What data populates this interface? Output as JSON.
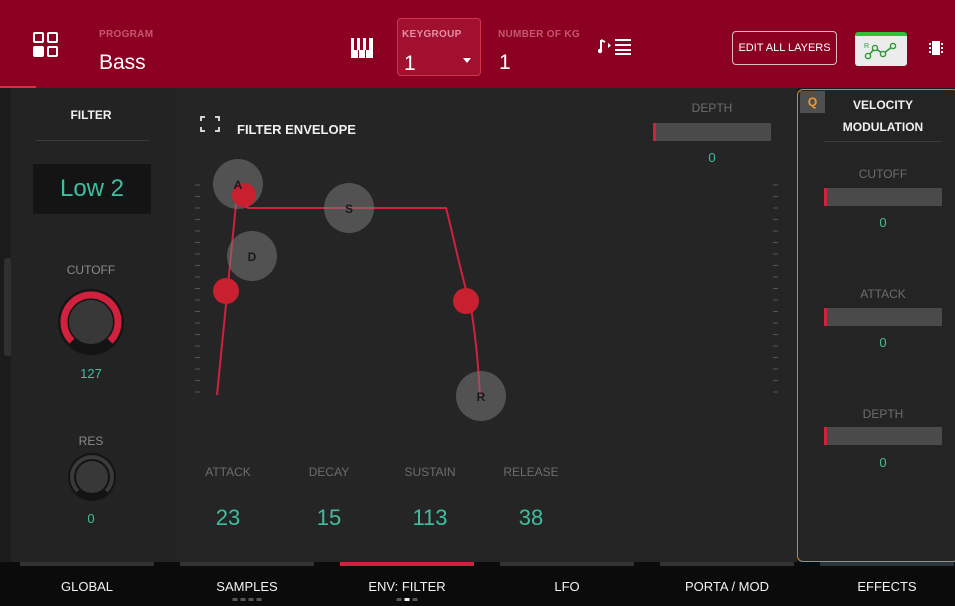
{
  "header": {
    "program_label": "PROGRAM",
    "program_value": "Bass",
    "keygroup_label": "KEYGROUP",
    "keygroup_value": "1",
    "num_kg_label": "NUMBER OF KG",
    "num_kg_value": "1",
    "edit_all_layers": "EDIT ALL LAYERS",
    "mod_button_letter": "R",
    "icons": [
      "grid-icon",
      "keyboard-icon",
      "note-list-icon",
      "modulation-icon",
      "chip-icon"
    ]
  },
  "filter": {
    "title": "FILTER",
    "type": "Low 2",
    "cutoff_label": "CUTOFF",
    "cutoff_value": "127",
    "cutoff_level": 1.0,
    "res_label": "RES",
    "res_value": "0",
    "res_level": 0.0
  },
  "envelope": {
    "title": "FILTER ENVELOPE",
    "depth_label": "DEPTH",
    "depth_value": "0",
    "handles": [
      "A",
      "S",
      "D",
      "R"
    ],
    "attack_label": "ATTACK",
    "attack_value": "23",
    "decay_label": "DECAY",
    "decay_value": "15",
    "sustain_label": "SUSTAIN",
    "sustain_value": "113",
    "release_label": "RELEASE",
    "release_value": "38"
  },
  "velocity": {
    "q_badge": "Q",
    "title_line1": "VELOCITY",
    "title_line2": "MODULATION",
    "cutoff_label": "CUTOFF",
    "cutoff_value": "0",
    "attack_label": "ATTACK",
    "attack_value": "0",
    "depth_label": "DEPTH",
    "depth_value": "0"
  },
  "tabs": [
    {
      "label": "GLOBAL",
      "active": false
    },
    {
      "label": "SAMPLES",
      "active": false
    },
    {
      "label": "ENV: FILTER",
      "active": true
    },
    {
      "label": "LFO",
      "active": false
    },
    {
      "label": "PORTA / MOD",
      "active": false
    },
    {
      "label": "EFFECTS",
      "active": false
    }
  ],
  "colors": {
    "header_bg": "#8c0022",
    "accent_red": "#d1213e",
    "value_teal": "#3fbf9f",
    "quick_edit_orange": "#d9822b"
  }
}
